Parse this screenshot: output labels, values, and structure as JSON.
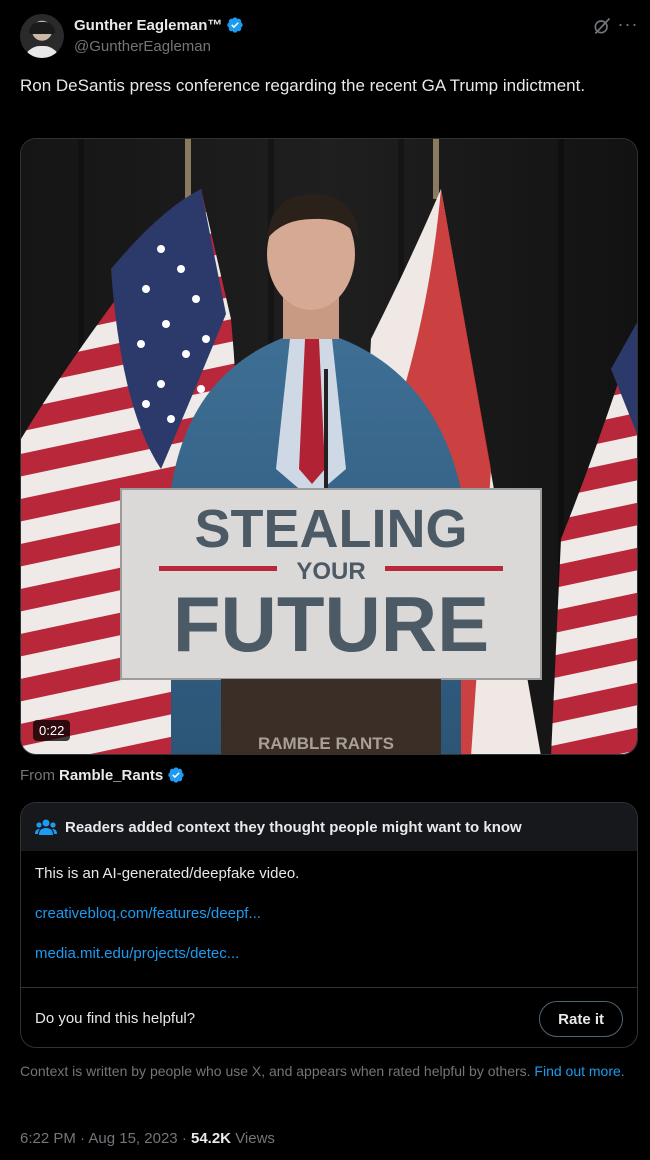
{
  "author": {
    "name": "Gunther Eagleman™",
    "handle": "@GuntherEagleman"
  },
  "tweet": {
    "text": "Ron DeSantis press conference regarding the recent GA Trump indictment."
  },
  "media": {
    "duration": "0:22",
    "podium_line1": "STEALING",
    "podium_line2": "YOUR",
    "podium_line3": "FUTURE",
    "watermark": "RAMBLE RANTS"
  },
  "source": {
    "label": "From",
    "name": "Ramble_Rants"
  },
  "community_note": {
    "title": "Readers added context they thought people might want to know",
    "text": "This is an AI-generated/deepfake video.",
    "links": [
      "creativebloq.com/features/deepf...",
      "media.mit.edu/projects/detec..."
    ],
    "helpful_prompt": "Do you find this helpful?",
    "rate_button": "Rate it"
  },
  "context_info": {
    "text": "Context is written by people who use X, and appears when rated helpful by others.",
    "link": "Find out more."
  },
  "meta": {
    "time": "6:22 PM",
    "separator": "·",
    "date": "Aug 15, 2023",
    "views_count": "54.2K",
    "views_label": "Views"
  },
  "colors": {
    "accent": "#1d9bf0",
    "background": "#000000",
    "muted": "#71767b",
    "border": "#2f3336"
  },
  "icons": [
    "verified-badge-icon",
    "grok-icon",
    "more-icon",
    "community-notes-icon"
  ]
}
